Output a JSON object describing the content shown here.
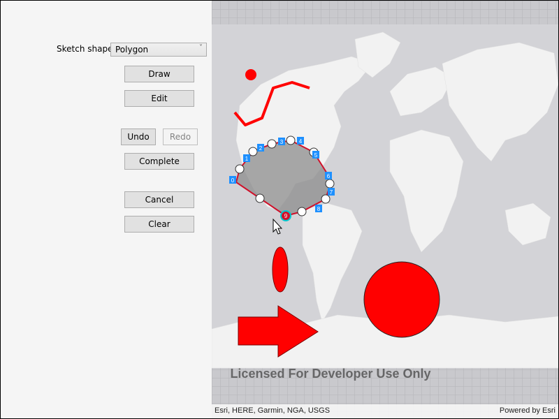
{
  "panel": {
    "shape_label": "Sketch shape:",
    "shape_select": {
      "value": "Polygon",
      "chevron": "˅"
    },
    "buttons": {
      "draw": "Draw",
      "edit": "Edit",
      "undo": "Undo",
      "redo": "Redo",
      "complete": "Complete",
      "cancel": "Cancel",
      "clear": "Clear"
    }
  },
  "map": {
    "watermark": "Licensed For Developer Use Only",
    "attribution_left": "Esri, HERE, Garmin, NGA, USGS",
    "attribution_right": "Powered by Esri",
    "sketch_vertex_labels": [
      "0",
      "1",
      "2",
      "3",
      "4",
      "5",
      "6",
      "7",
      "8",
      "9"
    ],
    "colors": {
      "graphic_fill": "#ff0000",
      "sketch_fill": "#8c8c8c",
      "vertex_label_bg": "#1e90ff",
      "selected_vertex": "#00c8d0"
    }
  }
}
